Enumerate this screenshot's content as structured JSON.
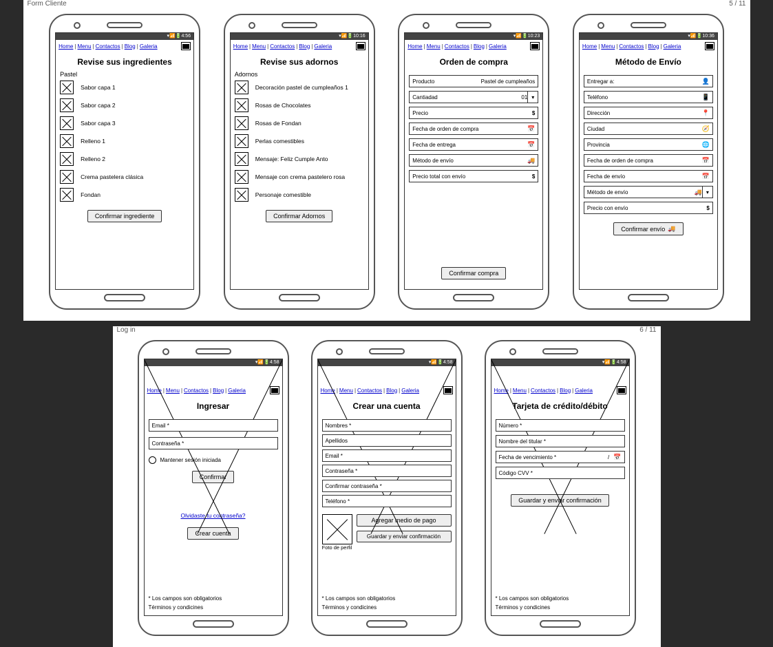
{
  "pages": [
    {
      "label": "Form Cliente",
      "num": "5 / 11"
    },
    {
      "label": "Log in",
      "num": "6 / 11"
    }
  ],
  "nav": {
    "home": "Home",
    "menu": "Menu",
    "contactos": "Contactos",
    "blog": "Blog",
    "galeria": "Galeria"
  },
  "status": {
    "t1": "4:56",
    "t2": "10:16",
    "t3": "10:23",
    "t4": "10:36",
    "t5": "4:58"
  },
  "s1": {
    "title": "Revise sus ingredientes",
    "section": "Pastel",
    "items": [
      "Sabor capa 1",
      "Sabor capa 2",
      "Sabor capa 3",
      "Relleno 1",
      "Relleno 2",
      "Crema pastelera clásica",
      "Fondan"
    ],
    "btn": "Confirmar ingrediente"
  },
  "s2": {
    "title": "Revise sus adornos",
    "section": "Adornos",
    "items": [
      "Decoración pastel de cumpleaños 1",
      "Rosas de Chocolates",
      "Rosas de Fondan",
      "Perlas comestibles",
      "Mensaje: Feliz Cumple Anto",
      "Mensaje con crema pastelero rosa",
      "Personaje comestible"
    ],
    "btn": "Confirmar Adornos"
  },
  "s3": {
    "title": "Orden de compra",
    "fields": [
      "Producto",
      "Cantiadad",
      "Precio",
      "Fecha de orden de compra",
      "Fecha de entrega",
      "Método de envío",
      "Precio total con envío"
    ],
    "product_val": "Pastel de cumpleaños",
    "qty": "01",
    "btn": "Confirmar compra"
  },
  "s4": {
    "title": "Método de Envío",
    "fields": [
      "Entregar a:",
      "Teléfono",
      "Dirección",
      "Ciudad",
      "Provincia",
      "Fecha de orden de compra",
      "Fecha de envío",
      "Método de envío",
      "Precio con envío"
    ],
    "btn": "Confirmar envío"
  },
  "s5": {
    "title": "Ingresar",
    "email": "Email *",
    "pass": "Contraseña *",
    "remember": "Mantener sesión iniciada",
    "btn": "Confirmar",
    "forgot": "Olvidaste tu contraseña?",
    "create": "Crear cuenta"
  },
  "s6": {
    "title": "Crear una cuenta",
    "fields": [
      "Nombres *",
      "Apellidos",
      "Email *",
      "Contraseña *",
      "Confirmar contraseña *",
      "Teléfono *"
    ],
    "photo": "Foto de perfil",
    "addpay": "Agregar medio de pago",
    "save": "Guardar y enviar confirmación"
  },
  "s7": {
    "title": "Tarjeta de crédito/débito",
    "num": "Número *",
    "holder": "Nombre del titular *",
    "expiry": "Fecha de vencimiento *",
    "slash": "/",
    "cvv": "Código CVV *",
    "btn": "Guardar y enviar confirmación"
  },
  "foot": {
    "req": "* Los campos son obligatorios",
    "terms": "Términos y condicines"
  }
}
